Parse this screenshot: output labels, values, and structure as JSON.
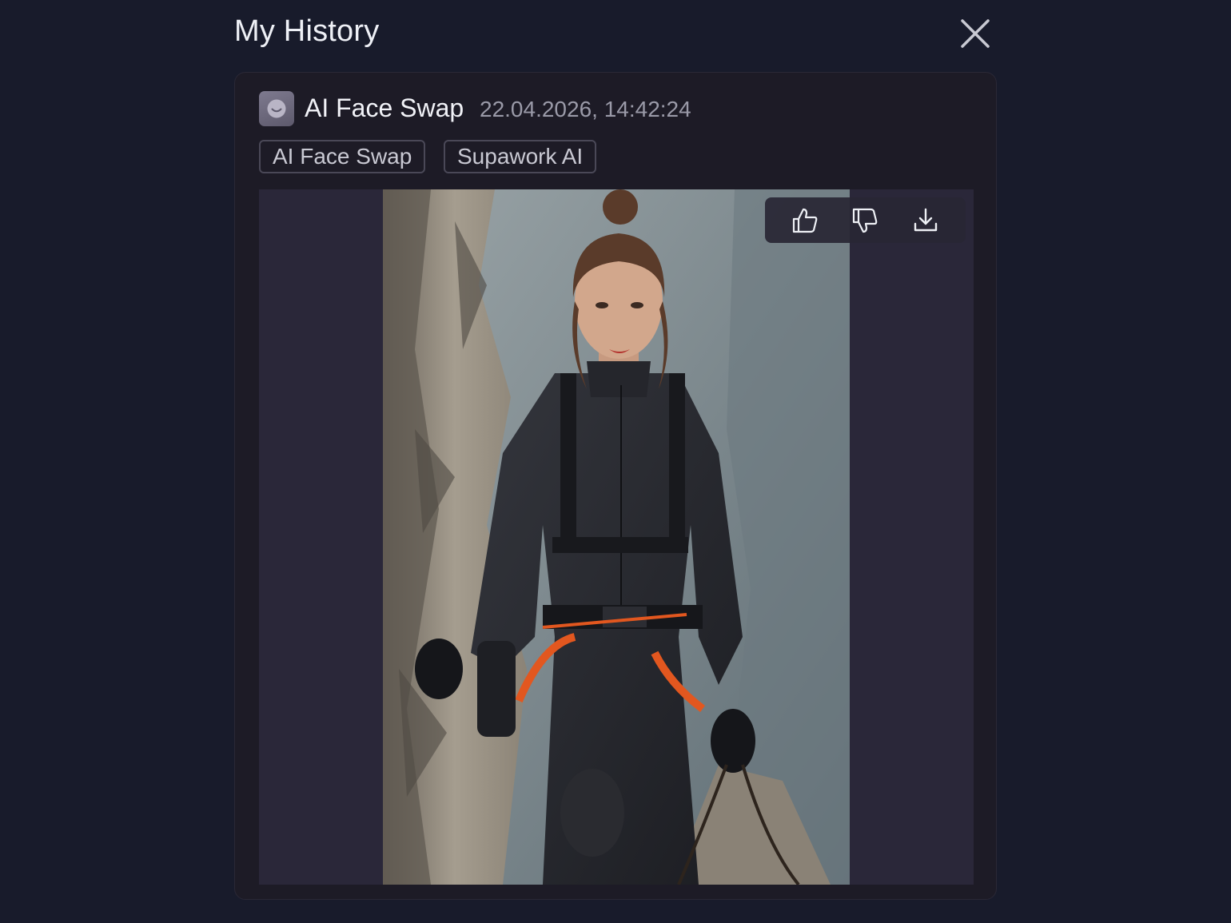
{
  "header": {
    "title": "My History"
  },
  "history_item": {
    "tool_name": "AI Face Swap",
    "timestamp": "22.04.2026, 14:42:24",
    "tags": [
      "AI Face Swap",
      "Supawork AI"
    ],
    "image": {
      "subject": "woman rock climber in black suit with orange harness"
    },
    "actions": [
      "thumbs-up-icon",
      "thumbs-down-icon",
      "download-icon"
    ]
  },
  "colors": {
    "background": "#181b2b",
    "card": "#1d1b26",
    "image_backdrop": "#2a2739",
    "accent_orange": "#e2571f"
  }
}
